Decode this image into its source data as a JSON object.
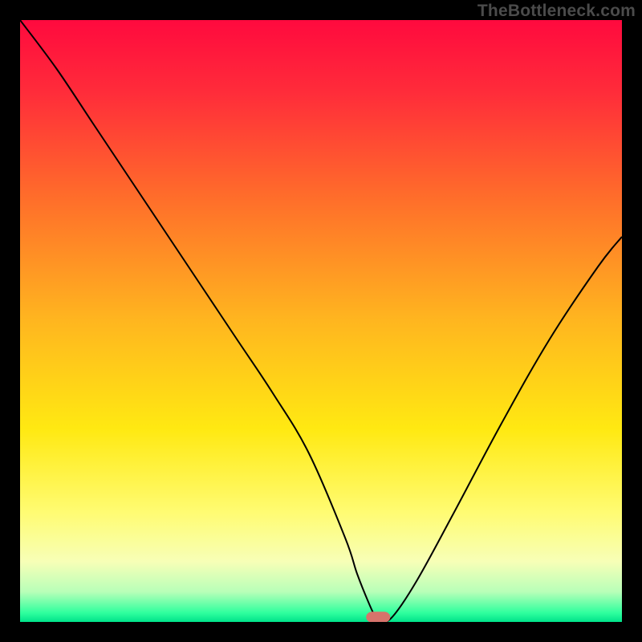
{
  "watermark": "TheBottleneck.com",
  "chart_data": {
    "type": "line",
    "title": "",
    "xlabel": "",
    "ylabel": "",
    "xlim": [
      0,
      100
    ],
    "ylim": [
      0,
      100
    ],
    "grid": false,
    "legend": false,
    "background": {
      "description": "Vertical gradient, red at top through orange/yellow to green at bottom",
      "stops": [
        {
          "pos": 0.0,
          "color": "#ff0a3e"
        },
        {
          "pos": 0.12,
          "color": "#ff2c3a"
        },
        {
          "pos": 0.3,
          "color": "#ff6f2a"
        },
        {
          "pos": 0.5,
          "color": "#ffb61f"
        },
        {
          "pos": 0.68,
          "color": "#ffe912"
        },
        {
          "pos": 0.82,
          "color": "#fffc74"
        },
        {
          "pos": 0.9,
          "color": "#f7ffb7"
        },
        {
          "pos": 0.95,
          "color": "#b8ffb8"
        },
        {
          "pos": 0.985,
          "color": "#2fff9e"
        },
        {
          "pos": 1.0,
          "color": "#00e28a"
        }
      ]
    },
    "series": [
      {
        "name": "bottleneck-curve",
        "color": "#000000",
        "x": [
          0,
          6,
          12,
          18,
          24,
          30,
          36,
          42,
          48,
          54,
          56,
          58,
          59,
          60,
          62,
          66,
          72,
          80,
          88,
          96,
          100
        ],
        "y": [
          100,
          92,
          83,
          74,
          65,
          56,
          47,
          38,
          28,
          14,
          8,
          3,
          1,
          0,
          1,
          7,
          18,
          33,
          47,
          59,
          64
        ]
      }
    ],
    "marker": {
      "name": "optimal-point",
      "shape": "rounded-capsule",
      "color": "#d6736b",
      "cx": 59.5,
      "cy": 0.8,
      "w": 4,
      "h": 1.8
    }
  }
}
